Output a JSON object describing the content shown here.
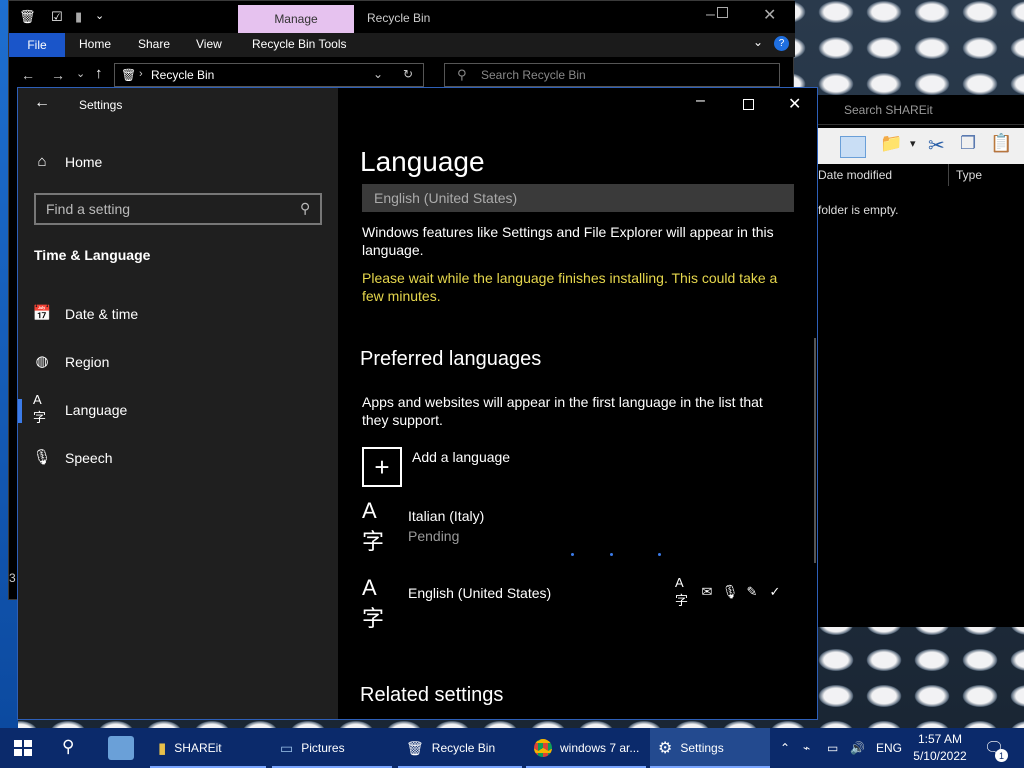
{
  "explorer": {
    "manage_tab": "Manage",
    "title": "Recycle Bin",
    "ribbon": [
      "File",
      "Home",
      "Share",
      "View",
      "Recycle Bin Tools"
    ],
    "address": "Recycle Bin",
    "search_placeholder": "Search Recycle Bin"
  },
  "explorer2": {
    "search_placeholder": "Search SHAREit",
    "column_date": "Date modified",
    "column_type": "Type",
    "empty_text": "folder is empty."
  },
  "settings": {
    "window_title": "Settings",
    "nav": {
      "home": "Home",
      "search_placeholder": "Find a setting",
      "section": "Time & Language",
      "items": [
        {
          "label": "Date & time",
          "icon": "calendar-clock-icon"
        },
        {
          "label": "Region",
          "icon": "globe-icon"
        },
        {
          "label": "Language",
          "icon": "language-icon"
        },
        {
          "label": "Speech",
          "icon": "microphone-icon"
        }
      ]
    },
    "main": {
      "title": "Language",
      "display_language_value": "English (United States)",
      "display_note": "Windows features like Settings and File Explorer will appear in this language.",
      "install_warning": "Please wait while the language finishes installing. This could take a few minutes.",
      "preferred_heading": "Preferred languages",
      "preferred_note": "Apps and websites will appear in the first language in the list that they support.",
      "add_language": "Add a language",
      "languages": [
        {
          "name": "Italian (Italy)",
          "status": "Pending"
        },
        {
          "name": "English (United States)",
          "status": ""
        }
      ],
      "related_heading": "Related settings"
    }
  },
  "taskbar": {
    "items": [
      {
        "label": "SHAREit"
      },
      {
        "label": "Pictures"
      },
      {
        "label": "Recycle Bin"
      },
      {
        "label": "windows 7 ar..."
      },
      {
        "label": "Settings"
      }
    ],
    "lang": "ENG",
    "time": "1:57 AM",
    "date": "5/10/2022",
    "notifications": "1"
  },
  "colors": {
    "accent": "#3b7be8",
    "warning": "#e6d74d",
    "taskbar": "#0b2a6b"
  }
}
